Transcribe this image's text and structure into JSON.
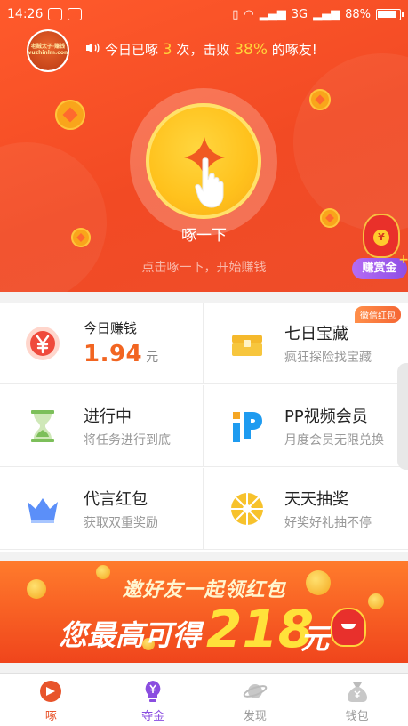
{
  "status_bar": {
    "time": "14:26",
    "network": "3G",
    "battery": "88%"
  },
  "hero": {
    "avatar_text": "老贼太子·赚钱 wuzhinlm.com",
    "notice_prefix": "今日已啄",
    "notice_count": "3",
    "notice_mid": "次，击败",
    "notice_percent": "38%",
    "notice_suffix": "的啄友!",
    "peck_label": "啄一下",
    "peck_hint": "点击啄一下，开始赚钱",
    "bounty_label": "赚赏金",
    "bounty_plus": "+",
    "bounty_coin": "¥"
  },
  "grid": {
    "today": {
      "title": "今日赚钱",
      "amount": "1.94",
      "unit": "元",
      "icon": "yen-coin-icon"
    },
    "treasure": {
      "title": "七日宝藏",
      "subtitle": "疯狂探险找宝藏",
      "badge": "微信红包",
      "icon": "treasure-chest-icon"
    },
    "progress": {
      "title": "进行中",
      "subtitle": "将任务进行到底",
      "icon": "hourglass-icon"
    },
    "pp_video": {
      "title": "PP视频会员",
      "subtitle": "月度会员无限兑换",
      "icon": "pp-logo-icon"
    },
    "endorse": {
      "title": "代言红包",
      "subtitle": "获取双重奖励",
      "icon": "crown-icon"
    },
    "lottery": {
      "title": "天天抽奖",
      "subtitle": "好奖好礼抽不停",
      "icon": "lottery-wheel-icon"
    }
  },
  "banner": {
    "line1": "邀好友一起领红包",
    "line2": "您最高可得",
    "amount": "218",
    "unit": "元"
  },
  "tabbar": [
    {
      "label": "啄",
      "icon": "peck-icon"
    },
    {
      "label": "夺金",
      "icon": "lightbulb-yen-icon"
    },
    {
      "label": "发现",
      "icon": "planet-icon"
    },
    {
      "label": "钱包",
      "icon": "wallet-bag-icon"
    }
  ],
  "colors": {
    "hero_bg": "#f24a24",
    "accent_orange": "#f26521",
    "gold": "#ffc21d",
    "purple": "#8a4de0"
  }
}
